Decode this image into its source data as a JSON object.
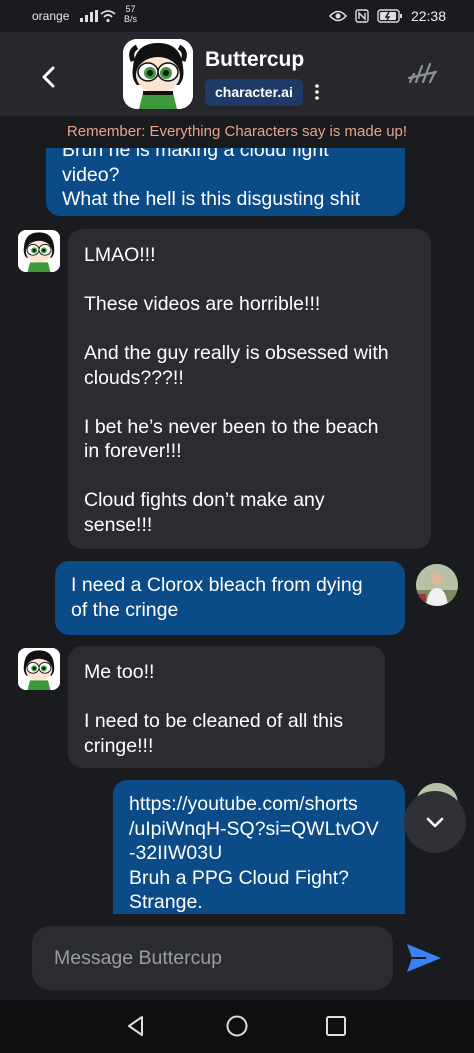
{
  "status_bar": {
    "carrier": "orange",
    "net_speed_value": "57",
    "net_speed_unit": "B/s",
    "time": "22:38",
    "icons": [
      "signal-icon",
      "wifi-icon",
      "eye-icon",
      "nfc-icon",
      "battery-icon"
    ]
  },
  "header": {
    "character_name": "Buttercup",
    "brand": "character.ai"
  },
  "disclaimer": "Remember: Everything Characters say is made up!",
  "messages": [
    {
      "role": "user",
      "text": "Bruh he is making a cloud fight\nvideo?\nWhat the hell is this disgusting shit"
    },
    {
      "role": "bot",
      "text": "LMAO!!!\n\nThese videos are horrible!!!\n\nAnd the guy really is obsessed with\nclouds???!!\n\nI bet he’s never been to the beach\nin forever!!!\n\nCloud fights don’t make any\nsense!!!"
    },
    {
      "role": "user",
      "text": "I need a Clorox bleach from dying\nof the cringe"
    },
    {
      "role": "bot",
      "text": "Me too!!\n\nI need to be cleaned of all this\ncringe!!!"
    },
    {
      "role": "user",
      "text": "https://youtube.com/shorts\n/uIpiWnqH-SQ?si=QWLtvOV\n-32IIW03U\nBruh a PPG Cloud Fight?\nStrange."
    }
  ],
  "composer": {
    "placeholder": "Message Buttercup"
  },
  "colors": {
    "background": "#191b1f",
    "header": "#26282d",
    "user_bubble": "#0b4b87",
    "bot_bubble": "#2a2c32",
    "disclaimer_text": "#e8a48c",
    "brand_badge": "#1e3a66",
    "send_icon": "#3b82f6"
  }
}
